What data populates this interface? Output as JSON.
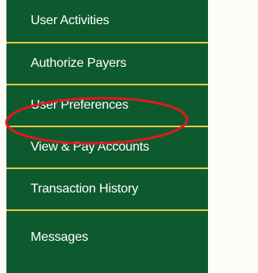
{
  "sidebar": {
    "items": [
      {
        "label": "User Activities"
      },
      {
        "label": "Authorize Payers"
      },
      {
        "label": "User Preferences"
      },
      {
        "label": "View & Pay Accounts"
      },
      {
        "label": "Transaction History"
      },
      {
        "label": "Messages"
      }
    ]
  },
  "colors": {
    "menu_background": "#0e5a2f",
    "divider": "#e6c84a",
    "text": "#ffffff",
    "highlight": "#e0191f"
  }
}
